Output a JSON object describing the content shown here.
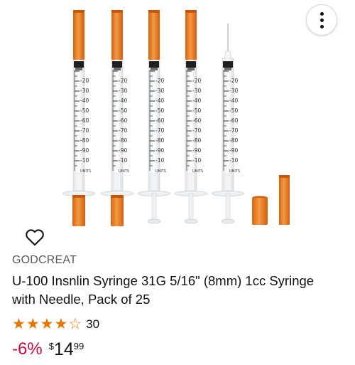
{
  "product": {
    "brand": "GODCREAT",
    "title": "U-100 Insnlin Syringe 31G 5/16\" (8mm) 1cc Syringe with Needle, Pack of 25",
    "rating": {
      "stars": 4.5,
      "count": "30"
    },
    "price": {
      "discount": "-6%",
      "currency": "$",
      "whole": "14",
      "fraction": "99"
    }
  },
  "image": {
    "syringe_scale_labels": [
      "-10",
      "-20",
      "-30",
      "-40",
      "-50",
      "-60",
      "-70",
      "-80",
      "-90",
      "-10",
      "UNITS"
    ]
  },
  "icons": {
    "more": "more-vertical-icon",
    "wishlist": "heart-outline-icon"
  },
  "colors": {
    "cap": "#ea7a1e",
    "star": "#e77600",
    "discount": "#cc0c39"
  }
}
